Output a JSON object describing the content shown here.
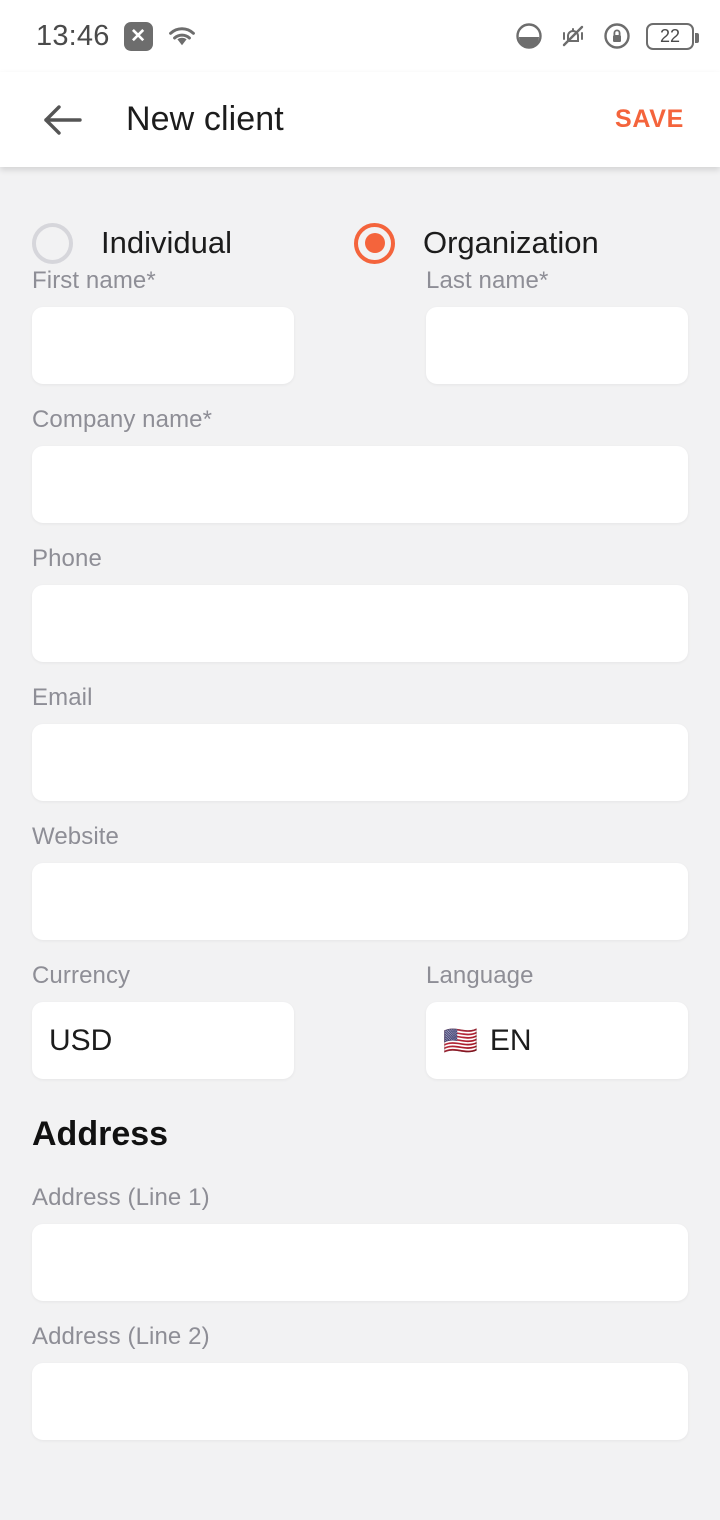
{
  "statusbar": {
    "time": "13:46",
    "x_badge": "✕",
    "icons": [
      "wifi-icon",
      "dnd-icon",
      "vibrate-mute-icon",
      "rotation-lock-icon"
    ],
    "battery_level": "22"
  },
  "appbar": {
    "back_icon": "back-arrow-icon",
    "title": "New client",
    "save_label": "SAVE"
  },
  "client_type": {
    "options": [
      {
        "label": "Individual",
        "selected": false
      },
      {
        "label": "Organization",
        "selected": true
      }
    ]
  },
  "form": {
    "first_name": {
      "label": "First name*",
      "value": "",
      "placeholder": ""
    },
    "last_name": {
      "label": "Last name*",
      "value": "",
      "placeholder": ""
    },
    "company_name": {
      "label": "Company name*",
      "value": "",
      "placeholder": ""
    },
    "phone": {
      "label": "Phone",
      "value": "",
      "placeholder": ""
    },
    "email": {
      "label": "Email",
      "value": "",
      "placeholder": ""
    },
    "website": {
      "label": "Website",
      "value": "",
      "placeholder": ""
    },
    "currency": {
      "label": "Currency",
      "value": "USD"
    },
    "language": {
      "label": "Language",
      "value": "EN",
      "flag": "🇺🇸"
    }
  },
  "address": {
    "section_title": "Address",
    "line1": {
      "label": "Address (Line 1)",
      "value": "",
      "placeholder": ""
    },
    "line2": {
      "label": "Address (Line 2)",
      "value": "",
      "placeholder": ""
    }
  },
  "colors": {
    "accent": "#f4643c",
    "background": "#f2f2f3",
    "surface": "#ffffff",
    "label": "#8e8e96",
    "text": "#1c1c1c"
  }
}
